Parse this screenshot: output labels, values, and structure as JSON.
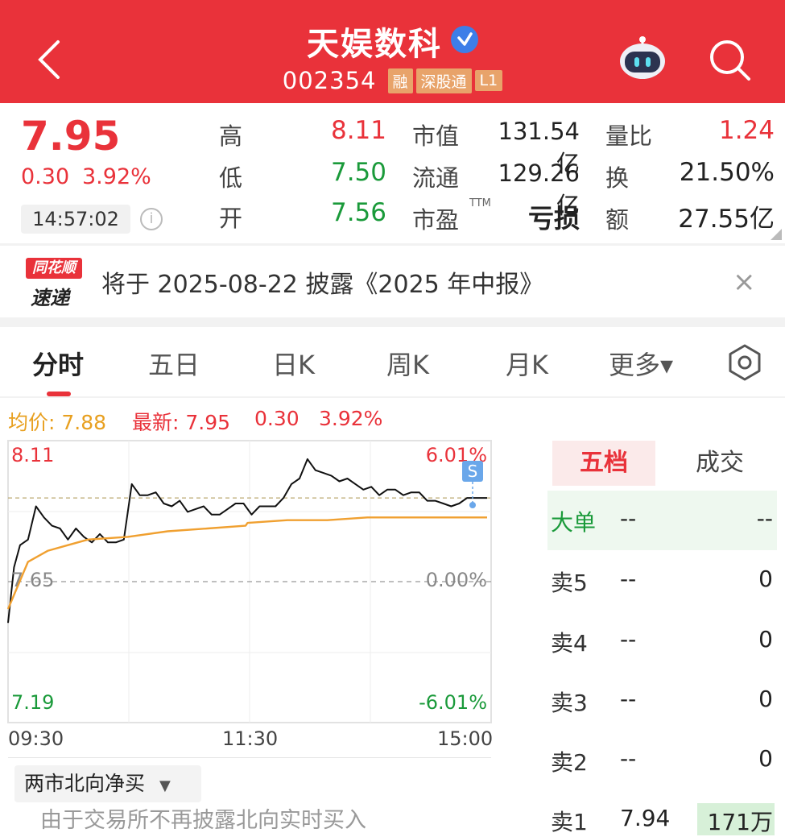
{
  "header": {
    "stock_name": "天娱数科",
    "stock_code": "002354",
    "tags": [
      "融",
      "深股通",
      "L1"
    ],
    "bg_color": "#e9323a"
  },
  "quote": {
    "price": "7.95",
    "change": "0.30",
    "change_pct": "3.92%",
    "time": "14:57:02",
    "info_icon_text": "i",
    "high_label": "高",
    "high": "8.11",
    "low_label": "低",
    "low": "7.50",
    "open_label": "开",
    "open": "7.56",
    "mktcap_label": "市值",
    "mktcap": "131.54亿",
    "float_label": "流通",
    "float": "129.26亿",
    "pe_label": "市盈",
    "pe_mark": "TTM",
    "pe": "亏损",
    "volratio_label": "量比",
    "volratio": "1.24",
    "turnover_label": "换",
    "turnover": "21.50%",
    "amount_label": "额",
    "amount": "27.55亿"
  },
  "news": {
    "logo_top": "同花顺",
    "logo_bottom": "速递",
    "text": "将于 2025-08-22 披露《2025 年中报》",
    "close": "×"
  },
  "tabs": [
    "分时",
    "五日",
    "日K",
    "周K",
    "月K",
    "更多▾"
  ],
  "chart_head": {
    "avg_label": "均价: 7.88",
    "latest_label": "最新: 7.95",
    "change": "0.30",
    "pct": "3.92%"
  },
  "chart_labels": {
    "y_top": "8.11",
    "y_mid": "7.65",
    "y_bot": "7.19",
    "pct_top": "6.01%",
    "pct_mid": "0.00%",
    "pct_bot": "-6.01%",
    "t_start": "09:30",
    "t_mid": "11:30",
    "t_end": "15:00",
    "s_marker": "S"
  },
  "chart_data": {
    "type": "line",
    "x_labels": [
      "09:30",
      "11:30",
      "15:00"
    ],
    "ylim": [
      7.19,
      8.11
    ],
    "prev_close": 7.65,
    "series": [
      {
        "name": "最新",
        "x": [
          0,
          3,
          6,
          10,
          14,
          18,
          22,
          26,
          30,
          34,
          38,
          42,
          46,
          50,
          54,
          58,
          62,
          66,
          70,
          74,
          78,
          82,
          86,
          90,
          94,
          98,
          102,
          106,
          110,
          114,
          118,
          122,
          126,
          130,
          134,
          138,
          142,
          146,
          150,
          154,
          158,
          162,
          166,
          170,
          174,
          178,
          182,
          186,
          190,
          194,
          198,
          202,
          206,
          210,
          214,
          218,
          222,
          226,
          230,
          234,
          238,
          240
        ],
        "values": [
          7.5,
          7.7,
          7.78,
          7.8,
          7.92,
          7.88,
          7.85,
          7.84,
          7.8,
          7.84,
          7.81,
          7.79,
          7.82,
          7.79,
          7.79,
          7.8,
          8.0,
          7.96,
          7.96,
          7.97,
          7.93,
          7.92,
          7.94,
          7.9,
          7.91,
          7.92,
          7.89,
          7.89,
          7.91,
          7.93,
          7.93,
          7.89,
          7.92,
          7.92,
          7.92,
          7.95,
          8.0,
          8.02,
          8.09,
          8.05,
          8.04,
          8.03,
          8.01,
          8.02,
          8.0,
          7.98,
          7.99,
          7.96,
          7.98,
          7.98,
          7.96,
          7.97,
          7.97,
          7.94,
          7.94,
          7.93,
          7.92,
          7.93,
          7.95,
          7.95,
          7.95,
          7.95
        ]
      },
      {
        "name": "均价",
        "x": [
          0,
          10,
          20,
          30,
          40,
          60,
          80,
          100,
          119,
          120,
          140,
          160,
          180,
          200,
          220,
          240
        ],
        "values": [
          7.55,
          7.72,
          7.76,
          7.78,
          7.8,
          7.81,
          7.83,
          7.84,
          7.85,
          7.86,
          7.87,
          7.87,
          7.88,
          7.88,
          7.88,
          7.88
        ]
      }
    ]
  },
  "north_bound": {
    "label": "两市北向净买",
    "hint": "由于交易所不再披露北向实时买入"
  },
  "order_book": {
    "tab_active": "五档",
    "tab_other": "成交",
    "big_label": "大单",
    "big_a": "--",
    "big_b": "--",
    "rows": [
      {
        "label": "卖5",
        "price": "--",
        "vol": "0"
      },
      {
        "label": "卖4",
        "price": "--",
        "vol": "0"
      },
      {
        "label": "卖3",
        "price": "--",
        "vol": "0"
      },
      {
        "label": "卖2",
        "price": "--",
        "vol": "0"
      },
      {
        "label": "卖1",
        "price": "7.94",
        "vol": "171万"
      }
    ]
  }
}
